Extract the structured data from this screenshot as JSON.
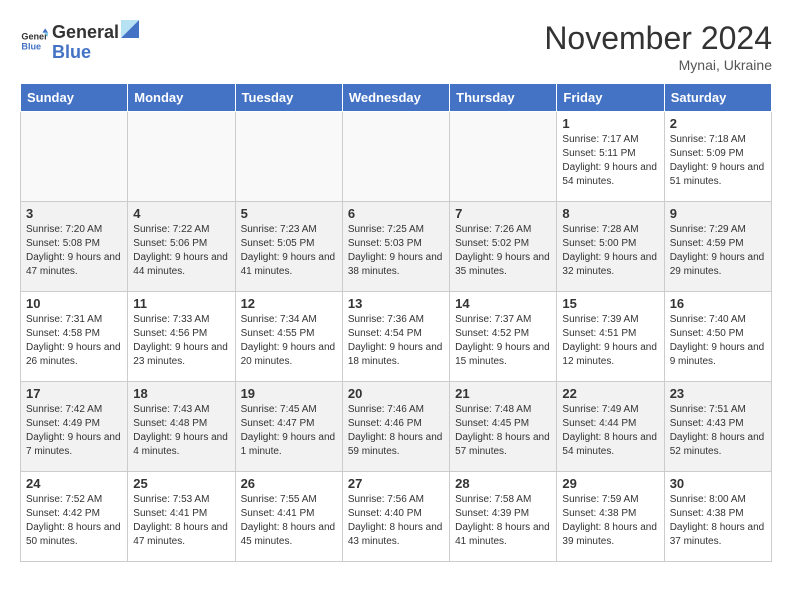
{
  "logo": {
    "text1": "General",
    "text2": "Blue"
  },
  "title": "November 2024",
  "location": "Mynai, Ukraine",
  "days_of_week": [
    "Sunday",
    "Monday",
    "Tuesday",
    "Wednesday",
    "Thursday",
    "Friday",
    "Saturday"
  ],
  "weeks": [
    {
      "style": "white",
      "days": [
        {
          "num": "",
          "info": ""
        },
        {
          "num": "",
          "info": ""
        },
        {
          "num": "",
          "info": ""
        },
        {
          "num": "",
          "info": ""
        },
        {
          "num": "",
          "info": ""
        },
        {
          "num": "1",
          "info": "Sunrise: 7:17 AM\nSunset: 5:11 PM\nDaylight: 9 hours and 54 minutes."
        },
        {
          "num": "2",
          "info": "Sunrise: 7:18 AM\nSunset: 5:09 PM\nDaylight: 9 hours and 51 minutes."
        }
      ]
    },
    {
      "style": "gray",
      "days": [
        {
          "num": "3",
          "info": "Sunrise: 7:20 AM\nSunset: 5:08 PM\nDaylight: 9 hours and 47 minutes."
        },
        {
          "num": "4",
          "info": "Sunrise: 7:22 AM\nSunset: 5:06 PM\nDaylight: 9 hours and 44 minutes."
        },
        {
          "num": "5",
          "info": "Sunrise: 7:23 AM\nSunset: 5:05 PM\nDaylight: 9 hours and 41 minutes."
        },
        {
          "num": "6",
          "info": "Sunrise: 7:25 AM\nSunset: 5:03 PM\nDaylight: 9 hours and 38 minutes."
        },
        {
          "num": "7",
          "info": "Sunrise: 7:26 AM\nSunset: 5:02 PM\nDaylight: 9 hours and 35 minutes."
        },
        {
          "num": "8",
          "info": "Sunrise: 7:28 AM\nSunset: 5:00 PM\nDaylight: 9 hours and 32 minutes."
        },
        {
          "num": "9",
          "info": "Sunrise: 7:29 AM\nSunset: 4:59 PM\nDaylight: 9 hours and 29 minutes."
        }
      ]
    },
    {
      "style": "white",
      "days": [
        {
          "num": "10",
          "info": "Sunrise: 7:31 AM\nSunset: 4:58 PM\nDaylight: 9 hours and 26 minutes."
        },
        {
          "num": "11",
          "info": "Sunrise: 7:33 AM\nSunset: 4:56 PM\nDaylight: 9 hours and 23 minutes."
        },
        {
          "num": "12",
          "info": "Sunrise: 7:34 AM\nSunset: 4:55 PM\nDaylight: 9 hours and 20 minutes."
        },
        {
          "num": "13",
          "info": "Sunrise: 7:36 AM\nSunset: 4:54 PM\nDaylight: 9 hours and 18 minutes."
        },
        {
          "num": "14",
          "info": "Sunrise: 7:37 AM\nSunset: 4:52 PM\nDaylight: 9 hours and 15 minutes."
        },
        {
          "num": "15",
          "info": "Sunrise: 7:39 AM\nSunset: 4:51 PM\nDaylight: 9 hours and 12 minutes."
        },
        {
          "num": "16",
          "info": "Sunrise: 7:40 AM\nSunset: 4:50 PM\nDaylight: 9 hours and 9 minutes."
        }
      ]
    },
    {
      "style": "gray",
      "days": [
        {
          "num": "17",
          "info": "Sunrise: 7:42 AM\nSunset: 4:49 PM\nDaylight: 9 hours and 7 minutes."
        },
        {
          "num": "18",
          "info": "Sunrise: 7:43 AM\nSunset: 4:48 PM\nDaylight: 9 hours and 4 minutes."
        },
        {
          "num": "19",
          "info": "Sunrise: 7:45 AM\nSunset: 4:47 PM\nDaylight: 9 hours and 1 minute."
        },
        {
          "num": "20",
          "info": "Sunrise: 7:46 AM\nSunset: 4:46 PM\nDaylight: 8 hours and 59 minutes."
        },
        {
          "num": "21",
          "info": "Sunrise: 7:48 AM\nSunset: 4:45 PM\nDaylight: 8 hours and 57 minutes."
        },
        {
          "num": "22",
          "info": "Sunrise: 7:49 AM\nSunset: 4:44 PM\nDaylight: 8 hours and 54 minutes."
        },
        {
          "num": "23",
          "info": "Sunrise: 7:51 AM\nSunset: 4:43 PM\nDaylight: 8 hours and 52 minutes."
        }
      ]
    },
    {
      "style": "white",
      "days": [
        {
          "num": "24",
          "info": "Sunrise: 7:52 AM\nSunset: 4:42 PM\nDaylight: 8 hours and 50 minutes."
        },
        {
          "num": "25",
          "info": "Sunrise: 7:53 AM\nSunset: 4:41 PM\nDaylight: 8 hours and 47 minutes."
        },
        {
          "num": "26",
          "info": "Sunrise: 7:55 AM\nSunset: 4:41 PM\nDaylight: 8 hours and 45 minutes."
        },
        {
          "num": "27",
          "info": "Sunrise: 7:56 AM\nSunset: 4:40 PM\nDaylight: 8 hours and 43 minutes."
        },
        {
          "num": "28",
          "info": "Sunrise: 7:58 AM\nSunset: 4:39 PM\nDaylight: 8 hours and 41 minutes."
        },
        {
          "num": "29",
          "info": "Sunrise: 7:59 AM\nSunset: 4:38 PM\nDaylight: 8 hours and 39 minutes."
        },
        {
          "num": "30",
          "info": "Sunrise: 8:00 AM\nSunset: 4:38 PM\nDaylight: 8 hours and 37 minutes."
        }
      ]
    }
  ]
}
